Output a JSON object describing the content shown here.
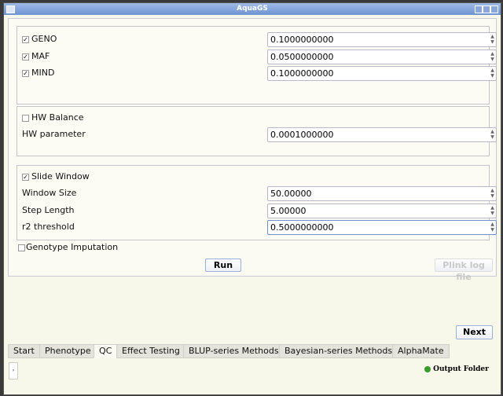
{
  "window": {
    "title": "AquaGS"
  },
  "filters": [
    {
      "label": "GENO",
      "checked": true,
      "value": "0.1000000000"
    },
    {
      "label": "MAF",
      "checked": true,
      "value": "0.0500000000"
    },
    {
      "label": "MIND",
      "checked": true,
      "value": "0.1000000000"
    }
  ],
  "hw": {
    "label": "HW Balance",
    "checked": false,
    "param_label": "HW parameter",
    "param_value": "0.0001000000"
  },
  "slide": {
    "label": "Slide Window",
    "checked": true,
    "window_size_label": "Window Size",
    "window_size": "50.00000",
    "step_label": "Step Length",
    "step": "5.00000",
    "r2_label": "r2 threshold",
    "r2": "0.5000000000"
  },
  "imputation": {
    "label": "Genotype Imputation",
    "checked": false
  },
  "buttons": {
    "run": "Run",
    "plink_log": "Plink log file",
    "next": "Next",
    "output_folder": "Output Folder"
  },
  "tabs": [
    "Start",
    "Phenotype",
    "QC",
    "Effect Testing",
    "BLUP-series Methods",
    "Bayesian-series Methods",
    "AlphaMate"
  ],
  "active_tab": "QC"
}
